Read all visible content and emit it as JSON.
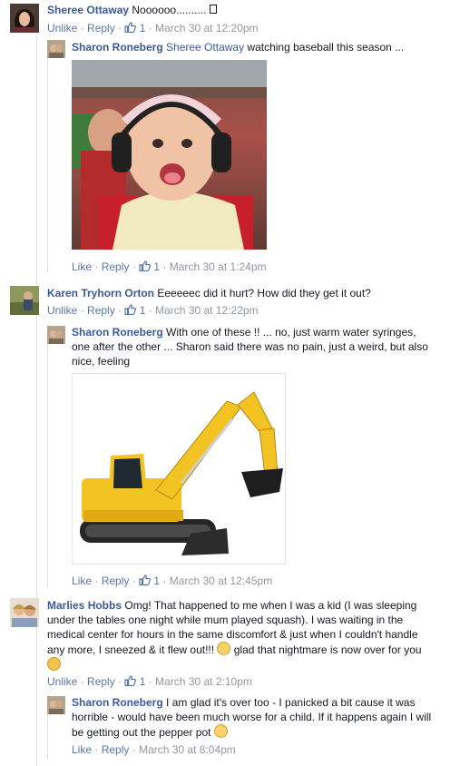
{
  "comments": [
    {
      "author": "Sheree Ottaway",
      "text": "Noooooo..........",
      "actions": {
        "primary": "Unlike",
        "reply": "Reply",
        "likes": "1",
        "time": "March 30 at 12:20pm"
      }
    },
    {
      "author": "Sharon Roneberg",
      "tag": "Sheree Ottaway",
      "text": "watching baseball this season ...",
      "actions": {
        "primary": "Like",
        "reply": "Reply",
        "likes": "1",
        "time": "March 30 at 1:24pm"
      }
    },
    {
      "author": "Karen Tryhorn Orton",
      "text": "Eeeeeec did it hurt? How did they get it out?",
      "actions": {
        "primary": "Unlike",
        "reply": "Reply",
        "likes": "1",
        "time": "March 30 at 12:22pm"
      }
    },
    {
      "author": "Sharon Roneberg",
      "text": "With one of these !! ... no, just warm water syringes, one after the other ... Sharon said there was no pain, just a weird, but also nice, feeling",
      "actions": {
        "primary": "Like",
        "reply": "Reply",
        "likes": "1",
        "time": "March 30 at 12:45pm"
      }
    },
    {
      "author": "Marlies Hobbs",
      "text": "Omg! That happened to me when I was a kid (I was sleeping under the tables one night while mum played squash). I was waiting in the medical center for hours in the same discomfort & just when I couldn't handle any more, I sneezed & it flew out!!!",
      "text_after_emoji": "glad that nightmare is now over for you",
      "actions": {
        "primary": "Unlike",
        "reply": "Reply",
        "likes": "1",
        "time": "March 30 at 2:10pm"
      }
    },
    {
      "author": "Sharon Roneberg",
      "text": "I am glad it's over too - I panicked a bit cause it was horrible - would have been much worse for a child. If it happens again I will be getting out the pepper pot",
      "actions": {
        "primary": "Like",
        "reply": "Reply",
        "time": "March 30 at 8:04pm"
      }
    }
  ],
  "separators": {
    "dot": "·"
  },
  "colors": {
    "link": "#3b5998",
    "meta": "#9197a3",
    "text": "#141823"
  },
  "icons": [
    "thumbs-up-icon",
    "unsure-emoji-icon",
    "smile-emoji-icon",
    "squint-emoji-icon"
  ]
}
